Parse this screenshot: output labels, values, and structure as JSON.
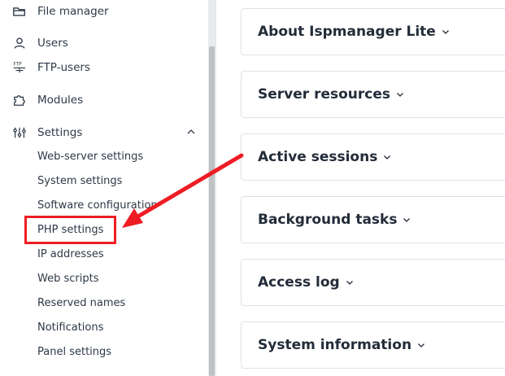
{
  "sidebar": {
    "items": [
      {
        "label": "File manager",
        "icon": "folder-icon"
      },
      {
        "label": "Users",
        "icon": "user-icon"
      },
      {
        "label": "FTP-users",
        "icon": "ftp-icon"
      },
      {
        "label": "Modules",
        "icon": "puzzle-icon"
      },
      {
        "label": "Settings",
        "icon": "sliders-icon",
        "expanded": true
      }
    ],
    "ftp_icon_text": "FTP",
    "settings_subitems": [
      "Web-server settings",
      "System settings",
      "Software configuration",
      "PHP settings",
      "IP addresses",
      "Web scripts",
      "Reserved names",
      "Notifications",
      "Panel settings"
    ],
    "highlighted_subitem": "PHP settings"
  },
  "main": {
    "cards": [
      {
        "title": "About Ispmanager Lite"
      },
      {
        "title": "Server resources"
      },
      {
        "title": "Active sessions"
      },
      {
        "title": "Background tasks"
      },
      {
        "title": "Access log"
      },
      {
        "title": "System information"
      }
    ]
  },
  "colors": {
    "highlight": "#ee1d24",
    "text": "#2e3947",
    "border": "#dfe2e7"
  }
}
